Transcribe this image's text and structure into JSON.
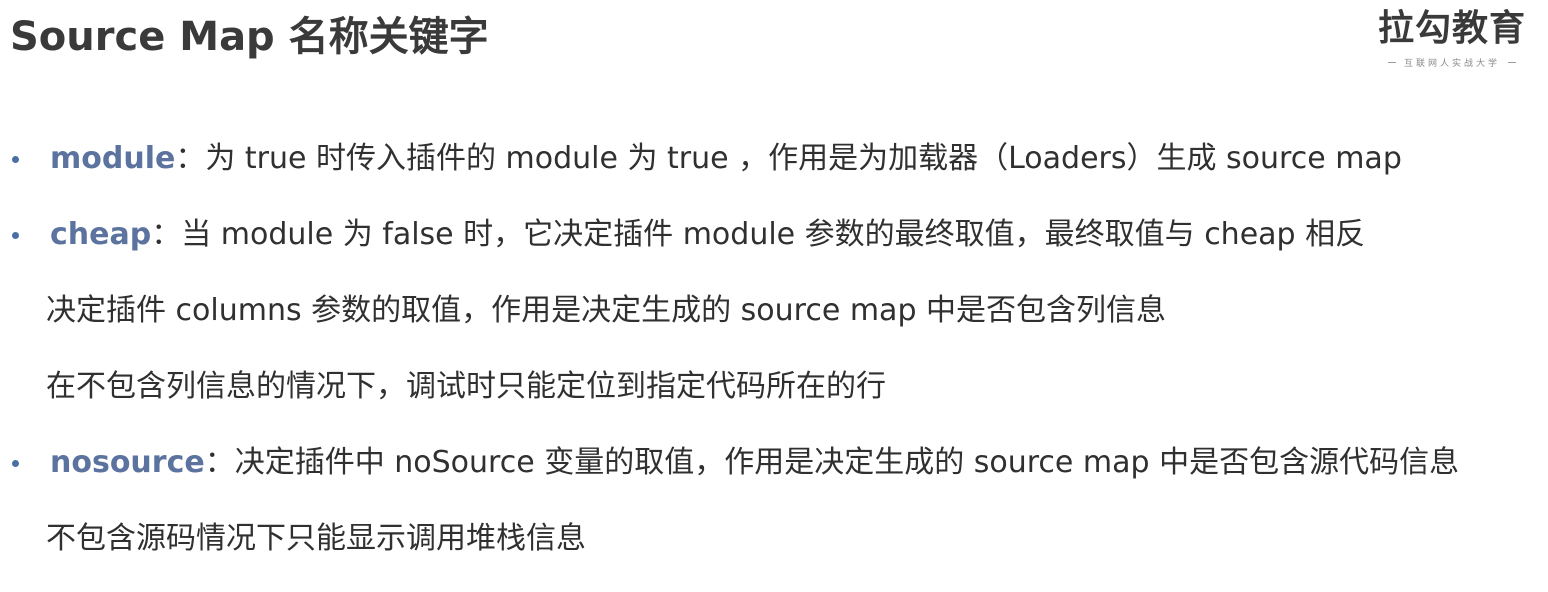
{
  "header": {
    "title": "Source Map 名称关键字"
  },
  "logo": {
    "name": "拉勾教育",
    "tagline": "互联网人实战大学"
  },
  "items": [
    {
      "keyword": "module",
      "text": "：为 true 时传入插件的 module 为 true ，作用是为加载器（Loaders）生成 source map"
    },
    {
      "keyword": "cheap",
      "text": "：当 module 为 false 时，它决定插件 module 参数的最终取值，最终取值与 cheap 相反"
    },
    {
      "text": "决定插件 columns 参数的取值，作用是决定生成的 source map 中是否包含列信息"
    },
    {
      "text": "在不包含列信息的情况下，调试时只能定位到指定代码所在的行"
    },
    {
      "keyword": "nosource",
      "text": "：决定插件中 noSource 变量的取值，作用是决定生成的 source map 中是否包含源代码信息"
    },
    {
      "text": "不包含源码情况下只能显示调用堆栈信息"
    }
  ]
}
